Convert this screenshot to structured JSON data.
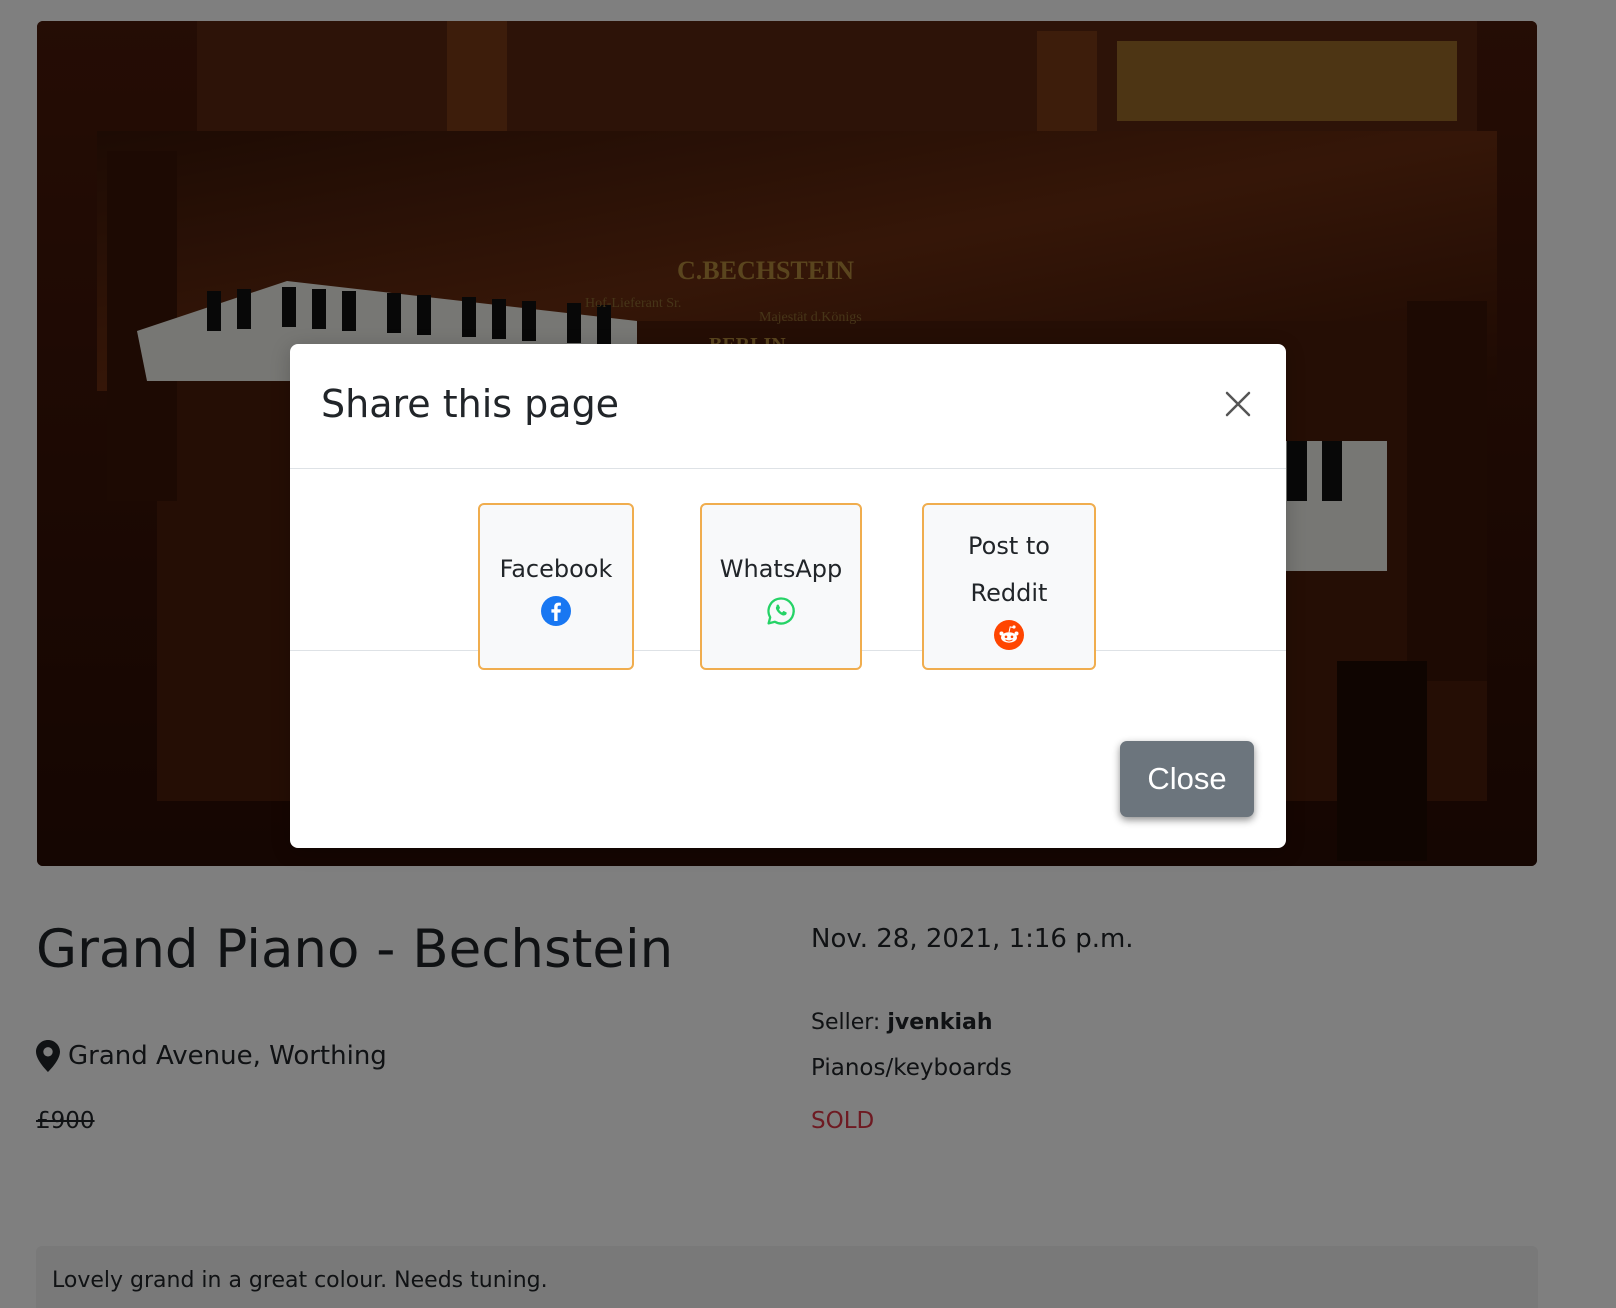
{
  "product": {
    "image_alt": "Grand piano photo",
    "brand_plate": {
      "line1": "C.BECHSTEIN",
      "line2_left": "Hof-Lieferant Sr.",
      "line2_right": "Majestät d.Königs",
      "line3": "BERLIN"
    },
    "title": "Grand Piano - Bechstein",
    "date": "Nov. 28, 2021, 1:16 p.m.",
    "location": "Grand Avenue, Worthing",
    "price": "£900",
    "seller_label": "Seller:",
    "seller_name": "jvenkiah",
    "category": "Pianos/keyboards",
    "status": "SOLD",
    "status_color": "#dc3545",
    "description": "Lovely grand in a great colour. Needs tuning."
  },
  "share_modal": {
    "title": "Share this page",
    "buttons": [
      {
        "label": "Facebook",
        "icon": "facebook-icon",
        "color": "#1877f2"
      },
      {
        "label": "WhatsApp",
        "icon": "whatsapp-icon",
        "color": "#25d366"
      },
      {
        "label": "Post to Reddit",
        "icon": "reddit-icon",
        "color": "#ff4500"
      }
    ],
    "close_label": "Close",
    "accent_border": "#f0ad4e"
  }
}
